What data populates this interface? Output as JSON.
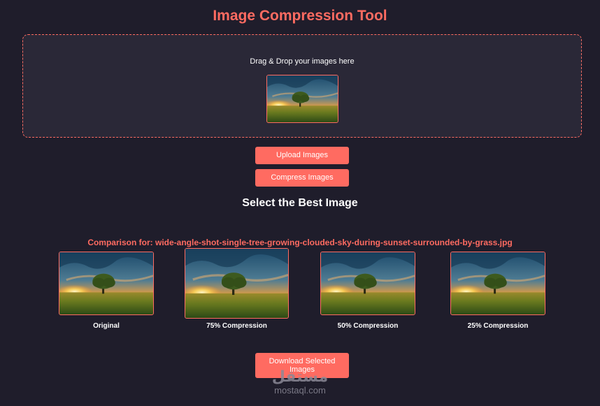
{
  "header": {
    "title": "Image Compression Tool"
  },
  "dropzone": {
    "text": "Drag & Drop your images here",
    "preview_icon": "landscape-thumbnail"
  },
  "buttons": {
    "upload": "Upload Images",
    "compress": "Compress Images",
    "download": "Download Selected Images"
  },
  "section": {
    "title": "Select the Best Image"
  },
  "comparison": {
    "label": "Comparison for: wide-angle-shot-single-tree-growing-clouded-sky-during-sunset-surrounded-by-grass.jpg",
    "options": [
      {
        "label": "Original"
      },
      {
        "label": "75% Compression"
      },
      {
        "label": "50% Compression"
      },
      {
        "label": "25% Compression"
      }
    ]
  },
  "watermark": {
    "logo": "مستقل",
    "site": "mostaql.com"
  },
  "colors": {
    "accent": "#ff6b61",
    "background": "#1f1d2b",
    "panel": "#2a2837"
  }
}
